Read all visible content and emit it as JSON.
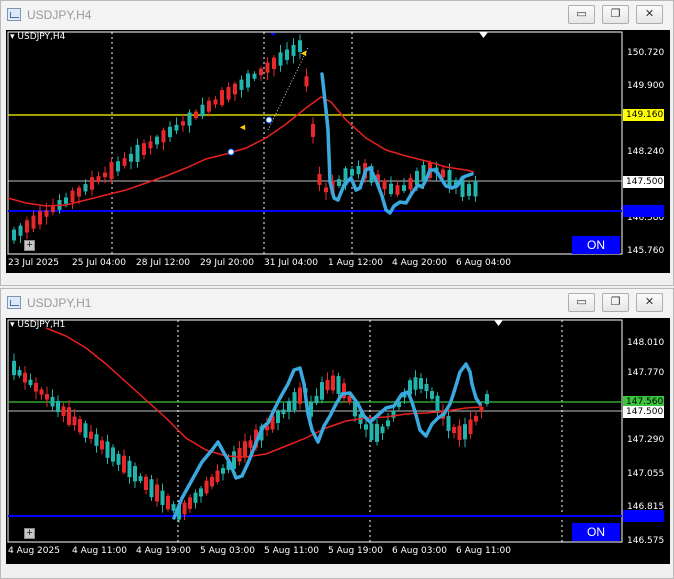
{
  "windows": [
    {
      "title": "USDJPY,H4",
      "chart_label": "USDJPY,H4",
      "on_label": "ON",
      "price_labels": [
        "150.720",
        "149.900",
        "148.240",
        "146.580",
        "145.760"
      ],
      "yellow_line_label": "149.160",
      "current_price_label": "147.500",
      "blue_line_label": "146.700",
      "time_labels": [
        "23 Jul 2025",
        "25 Jul 04:00",
        "28 Jul 12:00",
        "29 Jul 20:00",
        "31 Jul 04:00",
        "1 Aug 12:00",
        "4 Aug 20:00",
        "6 Aug 04:00"
      ],
      "colors": {
        "bull": "#22b5ad",
        "bear": "#e8282b",
        "ma": "#e82020",
        "drawn": "#3aa9e0",
        "yellow": "#ffff00",
        "blue": "#0000ff"
      }
    },
    {
      "title": "USDJPY,H1",
      "chart_label": "USDJPY,H1",
      "on_label": "ON",
      "price_labels": [
        "148.010",
        "147.770",
        "147.290",
        "147.055",
        "146.815",
        "146.575"
      ],
      "green_line_label": "147.560",
      "current_price_label": "147.500",
      "blue_line_label": "146.700",
      "time_labels": [
        "4 Aug 2025",
        "4 Aug 11:00",
        "4 Aug 19:00",
        "5 Aug 03:00",
        "5 Aug 11:00",
        "5 Aug 19:00",
        "6 Aug 03:00",
        "6 Aug 11:00"
      ],
      "colors": {
        "bull": "#22b5ad",
        "bear": "#e8282b",
        "ma": "#e82020",
        "drawn": "#3aa9e0",
        "green": "#39c43c",
        "blue": "#0000ff"
      }
    }
  ],
  "window_buttons": {
    "minimize": "▭",
    "restore": "❐",
    "close": "✕"
  }
}
